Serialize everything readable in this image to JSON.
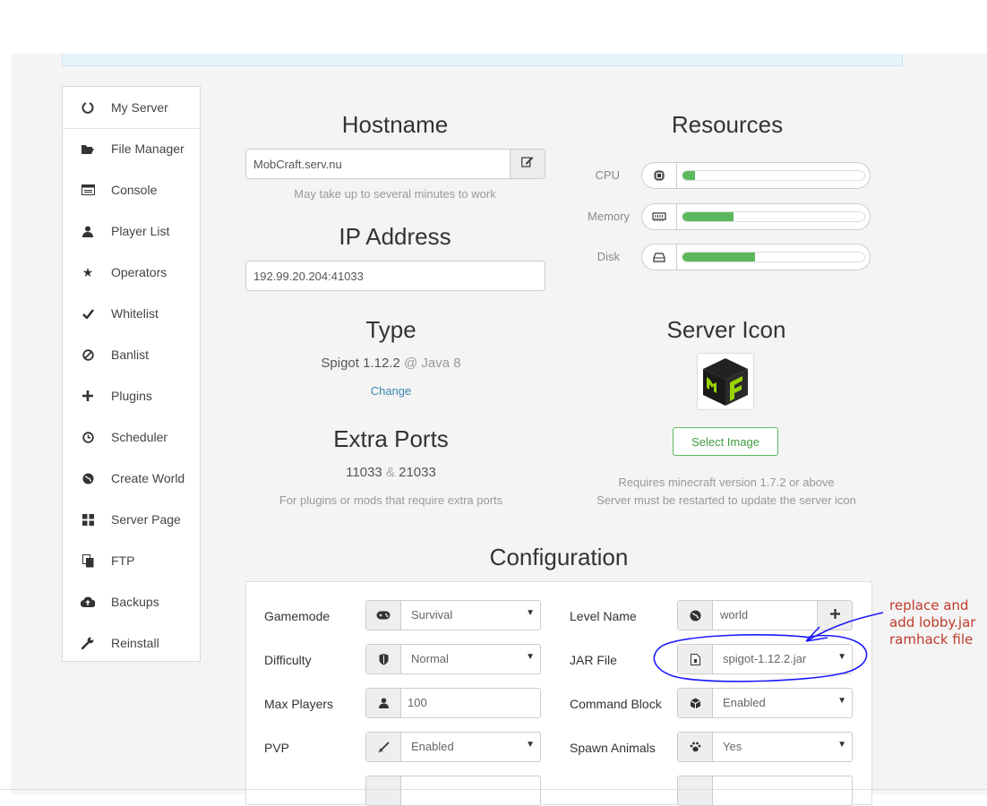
{
  "sidebar": {
    "items": [
      {
        "label": "My Server",
        "icon": "circle-notch-icon"
      },
      {
        "label": "File Manager",
        "icon": "folder-open-icon"
      },
      {
        "label": "Console",
        "icon": "terminal-icon"
      },
      {
        "label": "Player List",
        "icon": "user-icon"
      },
      {
        "label": "Operators",
        "icon": "star-icon"
      },
      {
        "label": "Whitelist",
        "icon": "check-icon"
      },
      {
        "label": "Banlist",
        "icon": "ban-icon"
      },
      {
        "label": "Plugins",
        "icon": "plus-icon"
      },
      {
        "label": "Scheduler",
        "icon": "clock-icon"
      },
      {
        "label": "Create World",
        "icon": "globe-icon"
      },
      {
        "label": "Server Page",
        "icon": "grid-icon"
      },
      {
        "label": "FTP",
        "icon": "files-icon"
      },
      {
        "label": "Backups",
        "icon": "cloud-upload-icon"
      },
      {
        "label": "Reinstall",
        "icon": "wrench-icon"
      }
    ]
  },
  "hostname": {
    "title": "Hostname",
    "value": "MobCraft.serv.nu",
    "hint": "May take up to several minutes to work"
  },
  "ip": {
    "title": "IP Address",
    "value": "192.99.20.204:41033"
  },
  "resources": {
    "title": "Resources",
    "items": [
      {
        "label": "CPU",
        "percent": 7
      },
      {
        "label": "Memory",
        "percent": 28
      },
      {
        "label": "Disk",
        "percent": 40
      }
    ]
  },
  "type": {
    "title": "Type",
    "software": "Spigot 1.12.2",
    "java": "@ Java 8",
    "change_label": "Change"
  },
  "server_icon": {
    "title": "Server Icon",
    "button_label": "Select Image",
    "note_line1": "Requires minecraft version 1.7.2 or above",
    "note_line2": "Server must be restarted to update the server icon"
  },
  "extra_ports": {
    "title": "Extra Ports",
    "port1": "11033",
    "amp": "&",
    "port2": "21033",
    "hint": "For plugins or mods that require extra ports"
  },
  "configuration": {
    "title": "Configuration",
    "left": [
      {
        "label": "Gamemode",
        "value": "Survival",
        "icon": "gamepad-icon",
        "dropdown": true
      },
      {
        "label": "Difficulty",
        "value": "Normal",
        "icon": "shield-icon",
        "dropdown": true
      },
      {
        "label": "Max Players",
        "value": "100",
        "icon": "user-icon",
        "dropdown": false
      },
      {
        "label": "PVP",
        "value": "Enabled",
        "icon": "sword-icon",
        "dropdown": true
      }
    ],
    "right": [
      {
        "label": "Level Name",
        "value": "world",
        "icon": "globe-icon",
        "dropdown": false
      },
      {
        "label": "JAR File",
        "value": "spigot-1.12.2.jar",
        "icon": "file-icon",
        "dropdown": true
      },
      {
        "label": "Command Block",
        "value": "Enabled",
        "icon": "cube-icon",
        "dropdown": true
      },
      {
        "label": "Spawn Animals",
        "value": "Yes",
        "icon": "paw-icon",
        "dropdown": true
      }
    ]
  },
  "annotation": {
    "line1": "replace and",
    "line2": "add lobby.jar",
    "line3": "ramhack file",
    "color": "#c0392b",
    "ink": "#1a1aff"
  }
}
